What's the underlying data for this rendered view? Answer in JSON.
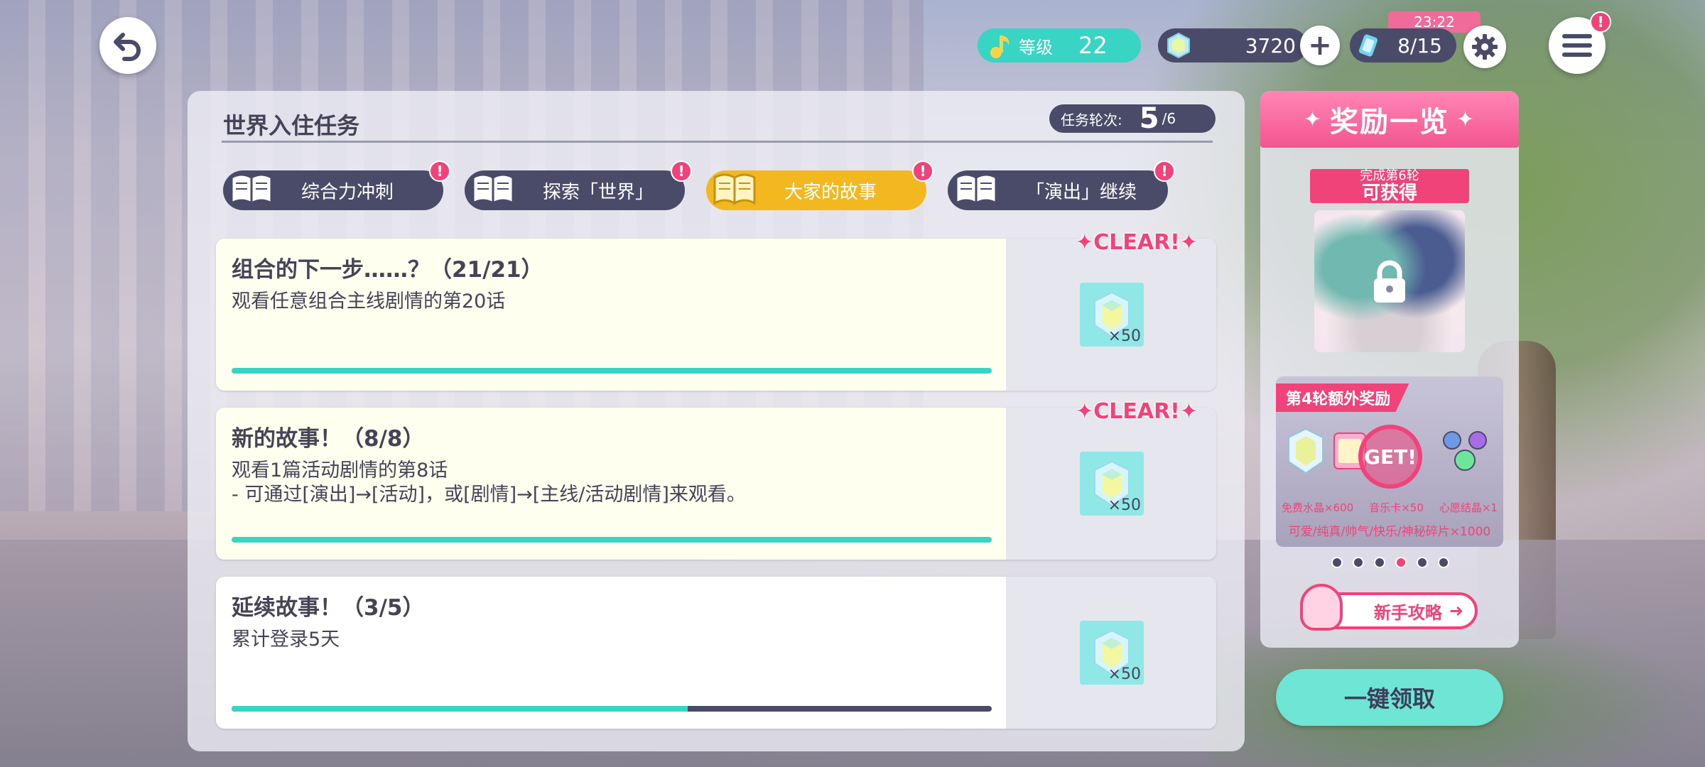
{
  "top_bar": {
    "level_label": "等级",
    "level_value": "22",
    "gems_value": "3720",
    "energy_value": "8/15",
    "energy_timer": "23:22",
    "menu_alert": "!"
  },
  "panel": {
    "title": "世界入住任务",
    "round_label": "任务轮次:",
    "round_current": "5",
    "round_total": "/6"
  },
  "tabs": [
    {
      "label": "综合力冲刺",
      "alert": "!"
    },
    {
      "label": "探索「世界」",
      "alert": "!"
    },
    {
      "label": "大家的故事",
      "alert": "!"
    },
    {
      "label": "「演出」继续",
      "alert": "!"
    }
  ],
  "tasks": [
    {
      "title": "组合的下一步……？（21/21）",
      "desc": "观看任意组合主线剧情的第20话",
      "desc2": "",
      "progress": 1.0,
      "reward_qty": "×50",
      "clear_label": "✦CLEAR!✦"
    },
    {
      "title": "新的故事！（8/8）",
      "desc": "观看1篇活动剧情的第8话",
      "desc2": "- 可通过[演出]→[活动]，或[剧情]→[主线/活动剧情]来观看。",
      "progress": 1.0,
      "reward_qty": "×50",
      "clear_label": "✦CLEAR!✦"
    },
    {
      "title": "延续故事！（3/5）",
      "desc": "累计登录5天",
      "desc2": "",
      "progress": 0.6,
      "reward_qty": "×50",
      "clear_label": ""
    }
  ],
  "reward_panel": {
    "header": "奖励一览",
    "ribbon_sub": "完成第6轮",
    "ribbon_main": "可获得",
    "bonus_tag": "第4轮额外奖励",
    "get_label": "GET!",
    "bonus_items": [
      "免费水晶×600",
      "音乐卡×50",
      "心愿结晶×1"
    ],
    "bonus_shards": "可爱/纯真/帅气/快乐/神秘碎片×1000",
    "guide_label": "新手攻略",
    "pager_total": 6,
    "pager_active": 4
  },
  "claim_button": "一键领取",
  "colors": {
    "accent_teal": "#38d4c4",
    "accent_pink": "#f0437a",
    "tab_active": "#f3b820",
    "dark_pill": "#4a4b68"
  }
}
